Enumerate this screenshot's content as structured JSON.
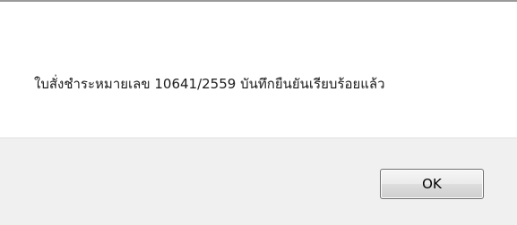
{
  "dialog": {
    "message": "ใบสั่งชำระหมายเลข 10641/2559 บันทึกยืนยันเรียบร้อยแล้ว",
    "ok_label": "OK"
  }
}
